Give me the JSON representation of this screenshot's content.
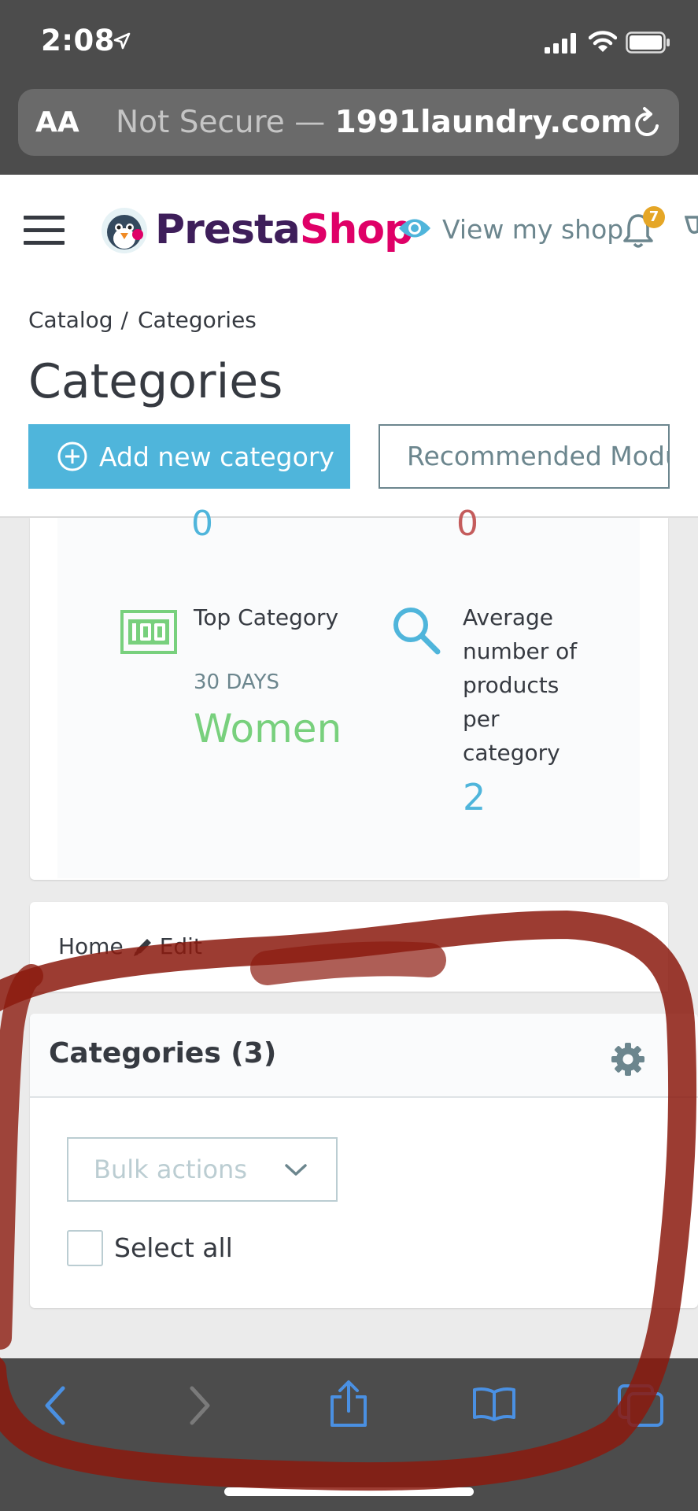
{
  "status_bar": {
    "time": "2:08"
  },
  "browser": {
    "text_size_label": "AA",
    "url_prefix": "Not Secure —",
    "url_domain": "1991laundry.com"
  },
  "header": {
    "logo_presta": "Presta",
    "logo_shop": "Shop",
    "view_shop_label": "View my shop",
    "notification_count": "7"
  },
  "breadcrumb": {
    "parent": "Catalog",
    "separator": "/",
    "current": "Categories"
  },
  "page": {
    "title": "Categories",
    "add_button_label": "Add new category",
    "recommended_button_label": "Recommended Modu"
  },
  "kpis": {
    "cut_left_value": "0",
    "cut_right_value": "0",
    "top_category": {
      "label": "Top Category",
      "period": "30 DAYS",
      "value": "Women"
    },
    "avg_products": {
      "label": "Average number of products per category",
      "value": "2"
    }
  },
  "category_nav": {
    "home_label": "Home",
    "edit_label": "Edit"
  },
  "categories_panel": {
    "title": "Categories (3)",
    "bulk_actions_label": "Bulk actions",
    "select_all_label": "Select all"
  },
  "colors": {
    "primary": "#4fb5db",
    "success": "#78d07d",
    "annotation": "#8b1a0e",
    "safari_chrome": "#4c4c4c",
    "ios_blue": "#4a90e2"
  }
}
